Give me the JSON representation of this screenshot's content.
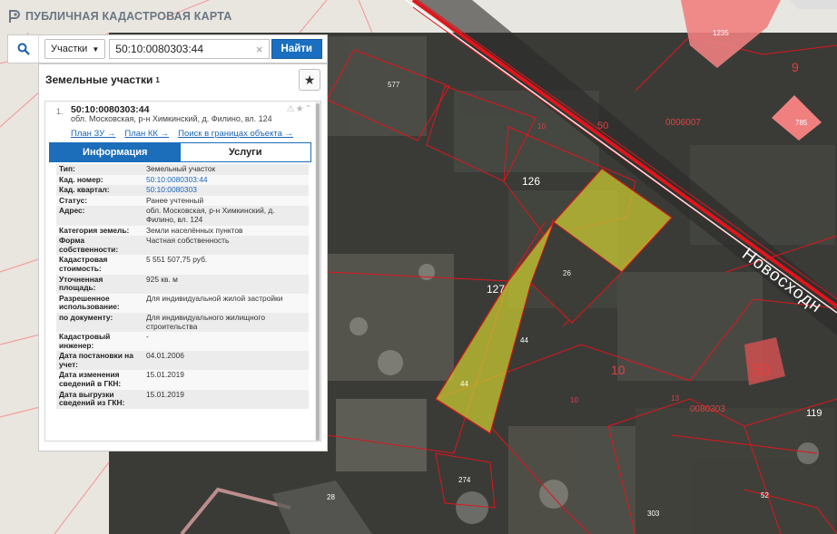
{
  "app": {
    "title": "ПУБЛИЧНАЯ КАДАСТРОВАЯ КАРТА"
  },
  "search": {
    "type_label": "Участки",
    "query": "50:10:0080303:44",
    "find_label": "Найти"
  },
  "panel": {
    "header": "Земельные участки",
    "count": "1",
    "item": {
      "index": "1.",
      "cadastral_number": "50:10:0080303:44",
      "address": "обл. Московская, р-н Химкинский, д. Филино, вл. 124",
      "links": [
        "План ЗУ →",
        "План КК →",
        "Поиск в границах объекта →"
      ]
    },
    "tabs": [
      "Информация",
      "Услуги"
    ],
    "fields": [
      {
        "key": "Тип:",
        "value": "Земельный участок"
      },
      {
        "key": "Кад. номер:",
        "value": "50:10:0080303:44",
        "link": true
      },
      {
        "key": "Кад. квартал:",
        "value": "50:10:0080303",
        "link": true
      },
      {
        "key": "Статус:",
        "value": "Ранее учтенный"
      },
      {
        "key": "Адрес:",
        "value": "обл. Московская, р-н Химкинский, д. Филино, вл. 124"
      },
      {
        "key": "Категория земель:",
        "value": "Земли населённых пунктов"
      },
      {
        "key": "Форма собственности:",
        "value": "Частная собственность"
      },
      {
        "key": "Кадастровая стоимость:",
        "value": "5 551 507,75 руб."
      },
      {
        "key": "Уточненная площадь:",
        "value": "925 кв. м"
      },
      {
        "key": "Разрешенное использование:",
        "value": "Для индивидуальной жилой застройки"
      },
      {
        "key": "по документу:",
        "value": "Для индивидуального жилищного строительства"
      },
      {
        "key": "Кадастровый инженер:",
        "value": "-"
      },
      {
        "key": "Дата постановки на учет:",
        "value": "04.01.2006"
      },
      {
        "key": "Дата изменения сведений в ГКН:",
        "value": "15.01.2019"
      },
      {
        "key": "Дата выгрузки сведений из ГКН:",
        "value": "15.01.2019"
      }
    ]
  },
  "map": {
    "street_name": "Новосходн",
    "labels": {
      "l577": "577",
      "l10a": "10",
      "l50a": "50",
      "l6007": "0006007",
      "l9": "9",
      "l785": "785",
      "l1235": "1235",
      "l126": "126",
      "l26": "26",
      "l127": "127",
      "l44a": "44",
      "l44b": "44",
      "l10b": "10",
      "l50b": "50",
      "l13": "13",
      "l0080303": "0080303",
      "l119": "119",
      "l10c": "10",
      "l274": "274",
      "l28": "28",
      "l303": "303",
      "l52": "52"
    },
    "colors": {
      "highlight": "#c8c832",
      "boundary": "#e0151b",
      "building": "#f08080",
      "map_bg": "#e9e6df"
    }
  }
}
